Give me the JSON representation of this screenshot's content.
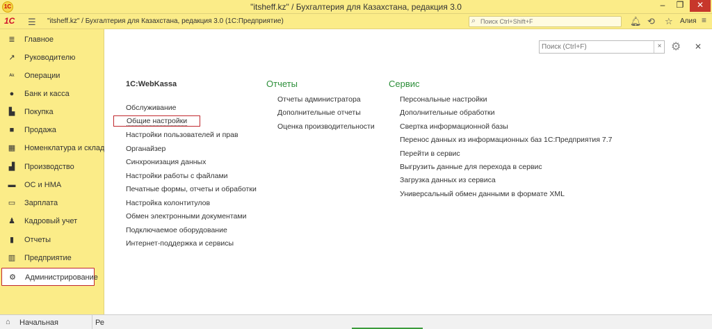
{
  "window": {
    "title": "\"itsheff.kz\" / Бухгалтерия для Казахстана, редакция 3.0",
    "min": "–",
    "max": "❐",
    "close": "✕"
  },
  "toolbar": {
    "logo": "1С",
    "app_title": "\"itsheff.kz\" / Бухгалтерия для Казахстана, редакция 3.0  (1С:Предприятие)",
    "search_placeholder": "Поиск Ctrl+Shift+F",
    "user": "Алия"
  },
  "sidebar": {
    "items": [
      {
        "label": "Главное",
        "icon": "list-icon"
      },
      {
        "label": "Руководителю",
        "icon": "trend-icon"
      },
      {
        "label": "Операции",
        "icon": "operations-icon"
      },
      {
        "label": "Банк и касса",
        "icon": "bank-icon"
      },
      {
        "label": "Покупка",
        "icon": "cart-icon"
      },
      {
        "label": "Продажа",
        "icon": "bag-icon"
      },
      {
        "label": "Номенклатура и склад",
        "icon": "warehouse-icon"
      },
      {
        "label": "Производство",
        "icon": "factory-icon"
      },
      {
        "label": "ОС и НМА",
        "icon": "truck-icon"
      },
      {
        "label": "Зарплата",
        "icon": "money-icon"
      },
      {
        "label": "Кадровый учет",
        "icon": "people-icon"
      },
      {
        "label": "Отчеты",
        "icon": "chart-icon"
      },
      {
        "label": "Предприятие",
        "icon": "building-icon"
      },
      {
        "label": "Администрирование",
        "icon": "gear-icon"
      }
    ]
  },
  "main": {
    "search_placeholder": "Поиск (Ctrl+F)",
    "columns": [
      {
        "header": "1С:WebKassa",
        "links": [
          "Обслуживание",
          "Общие настройки",
          "Настройки пользователей и прав",
          "Органайзер",
          "Синхронизация данных",
          "Настройки работы с файлами",
          "Печатные формы, отчеты и обработки",
          "Настройка колонтитулов",
          "Обмен электронными документами",
          "Подключаемое оборудование",
          "Интернет-поддержка и сервисы"
        ]
      },
      {
        "header": "Отчеты",
        "links": [
          "Отчеты администратора",
          "Дополнительные отчеты",
          "Оценка производительности"
        ]
      },
      {
        "header": "Сервис",
        "links": [
          "Персональные настройки",
          "Дополнительные обработки",
          "Свертка информационной базы",
          "Перенос данных из информационных баз 1С:Предприятия 7.7",
          "Перейти в сервис",
          "Выгрузить данные для перехода в сервис",
          "Загрузка данных из сервиса",
          "Универсальный обмен данными в формате XML"
        ]
      }
    ]
  },
  "bottom": {
    "home_label": "Начальная страница",
    "next_tab": "Ре"
  },
  "colors": {
    "accent_yellow": "#fbec88",
    "highlight_red": "#c0272d",
    "header_green": "#2d8f3a"
  }
}
